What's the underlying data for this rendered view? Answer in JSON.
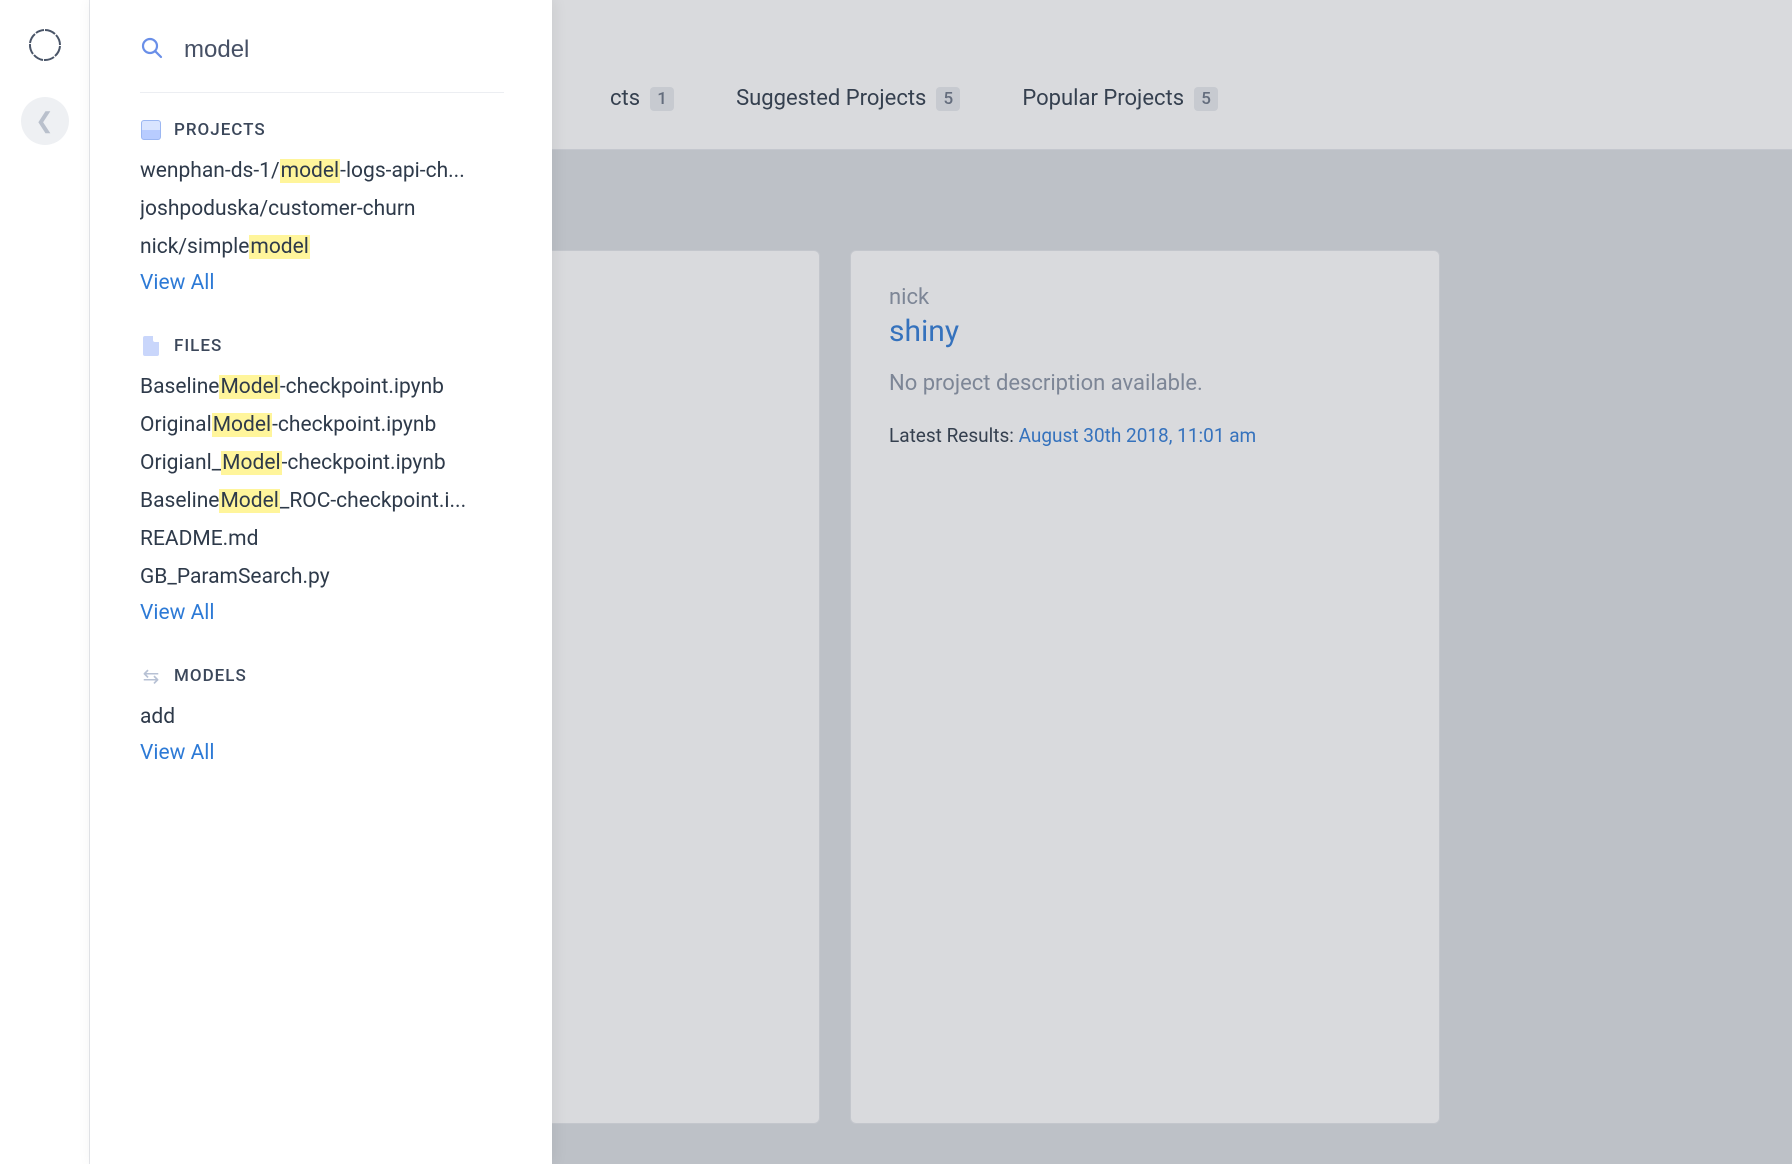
{
  "search": {
    "value": "model",
    "placeholder": "Search",
    "view_all_label": "View All"
  },
  "sections": {
    "projects": {
      "label": "PROJECTS",
      "items": [
        {
          "pre": "wenphan-ds-1/",
          "hl": "model",
          "post": "-logs-api-ch..."
        },
        {
          "pre": "joshpoduska/customer-churn",
          "hl": "",
          "post": ""
        },
        {
          "pre": "nick/simple",
          "hl": "model",
          "post": ""
        }
      ]
    },
    "files": {
      "label": "FILES",
      "items": [
        {
          "pre": "Baseline",
          "hl": "Model",
          "post": "-checkpoint.ipynb"
        },
        {
          "pre": "Original",
          "hl": "Model",
          "post": "-checkpoint.ipynb"
        },
        {
          "pre": "Origianl_",
          "hl": "Model",
          "post": "-checkpoint.ipynb"
        },
        {
          "pre": "Baseline",
          "hl": "Model",
          "post": "_ROC-checkpoint.i..."
        },
        {
          "pre": "README.md",
          "hl": "",
          "post": ""
        },
        {
          "pre": "GB_ParamSearch.py",
          "hl": "",
          "post": ""
        }
      ]
    },
    "models": {
      "label": "MODELS",
      "items": [
        {
          "pre": "add",
          "hl": "",
          "post": ""
        }
      ]
    }
  },
  "tabs": [
    {
      "label_partial": "cts",
      "count": "1"
    },
    {
      "label": "Suggested Projects",
      "count": "5"
    },
    {
      "label": "Popular Projects",
      "count": "5"
    }
  ],
  "card": {
    "owner": "nick",
    "title": "shiny",
    "desc": "No project description available.",
    "latest_label": "Latest Results: ",
    "latest_ts": "August 30th 2018, 11:01 am"
  }
}
